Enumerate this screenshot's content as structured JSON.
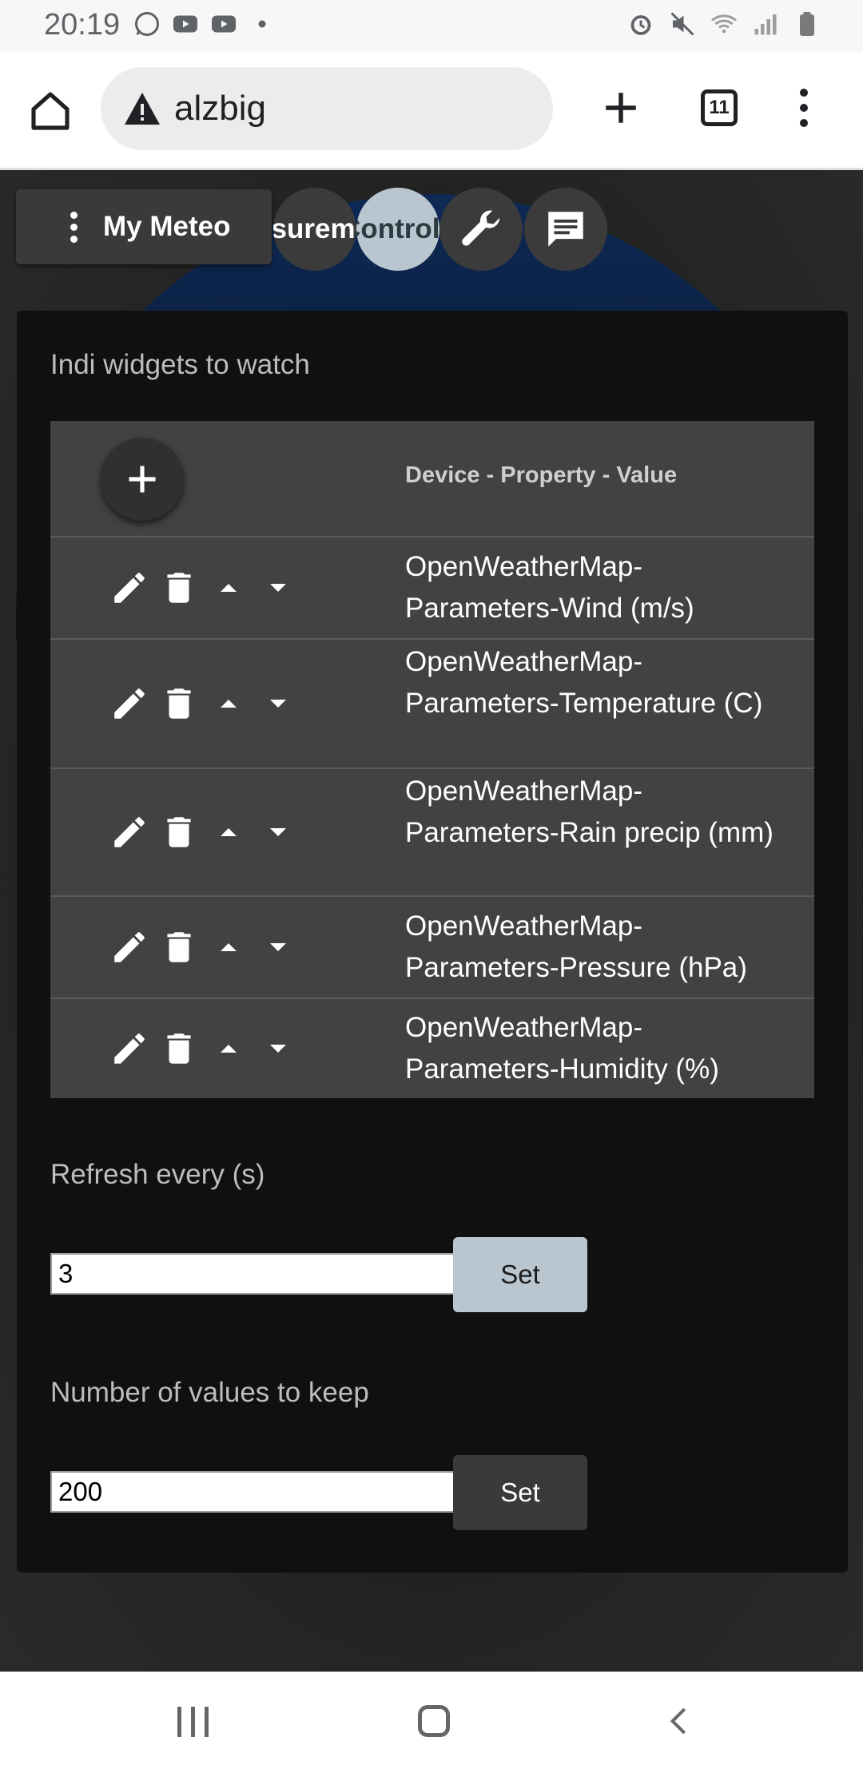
{
  "status_bar": {
    "time": "20:19",
    "left_icons": [
      "whatsapp-icon",
      "youtube-icon",
      "youtube-icon",
      "dot-icon"
    ],
    "right_icons": [
      "alarm-icon",
      "mute-icon",
      "wifi-icon",
      "signal-icon",
      "battery-icon"
    ]
  },
  "browser": {
    "url": "alzbig",
    "tab_count": "11"
  },
  "app": {
    "menu_label": "My Meteo",
    "tabs": [
      {
        "label": "Measurements",
        "active": false
      },
      {
        "label": "Controls",
        "active": true
      }
    ]
  },
  "panel": {
    "title": "Indi widgets to watch",
    "column_header": "Device - Property - Value",
    "rows": [
      {
        "text": "OpenWeatherMap-Parameters-Wind (m/s)"
      },
      {
        "text": "OpenWeatherMap-Parameters-Temperature (C)"
      },
      {
        "text": "OpenWeatherMap-Parameters-Rain precip (mm)"
      },
      {
        "text": "OpenWeatherMap-Parameters-Pressure (hPa)"
      },
      {
        "text": "OpenWeatherMap-Parameters-Humidity (%)"
      }
    ],
    "refresh": {
      "label": "Refresh every (s)",
      "value": "3",
      "button": "Set"
    },
    "keep": {
      "label": "Number of values to keep",
      "value": "200",
      "button": "Set"
    }
  },
  "colors": {
    "accent_button": "#b9c6cf",
    "dark_button": "#3a3a3a",
    "table_bg": "#424242",
    "panel_bg": "#101010"
  }
}
